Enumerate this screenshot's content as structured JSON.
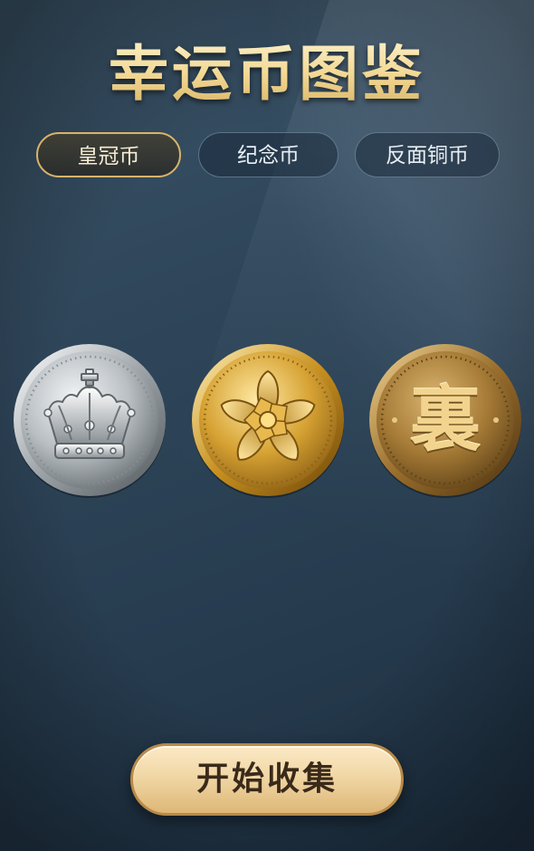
{
  "title": "幸运币图鉴",
  "tabs": [
    {
      "label": "皇冠币",
      "active": true
    },
    {
      "label": "纪念币",
      "active": false
    },
    {
      "label": "反面铜币",
      "active": false
    }
  ],
  "coins": [
    {
      "icon": "crown-icon",
      "metal": "silver"
    },
    {
      "icon": "flower-icon",
      "metal": "gold"
    },
    {
      "icon": "character-icon",
      "metal": "bronze",
      "character": "裏"
    }
  ],
  "colors": {
    "title_gold": "#f3d995",
    "tab_active_border": "#d8b46a",
    "button_fill": "#f1d7a5",
    "button_text": "#3a2a1a",
    "background": "#2f465a"
  },
  "start_button": {
    "label": "开始收集"
  }
}
